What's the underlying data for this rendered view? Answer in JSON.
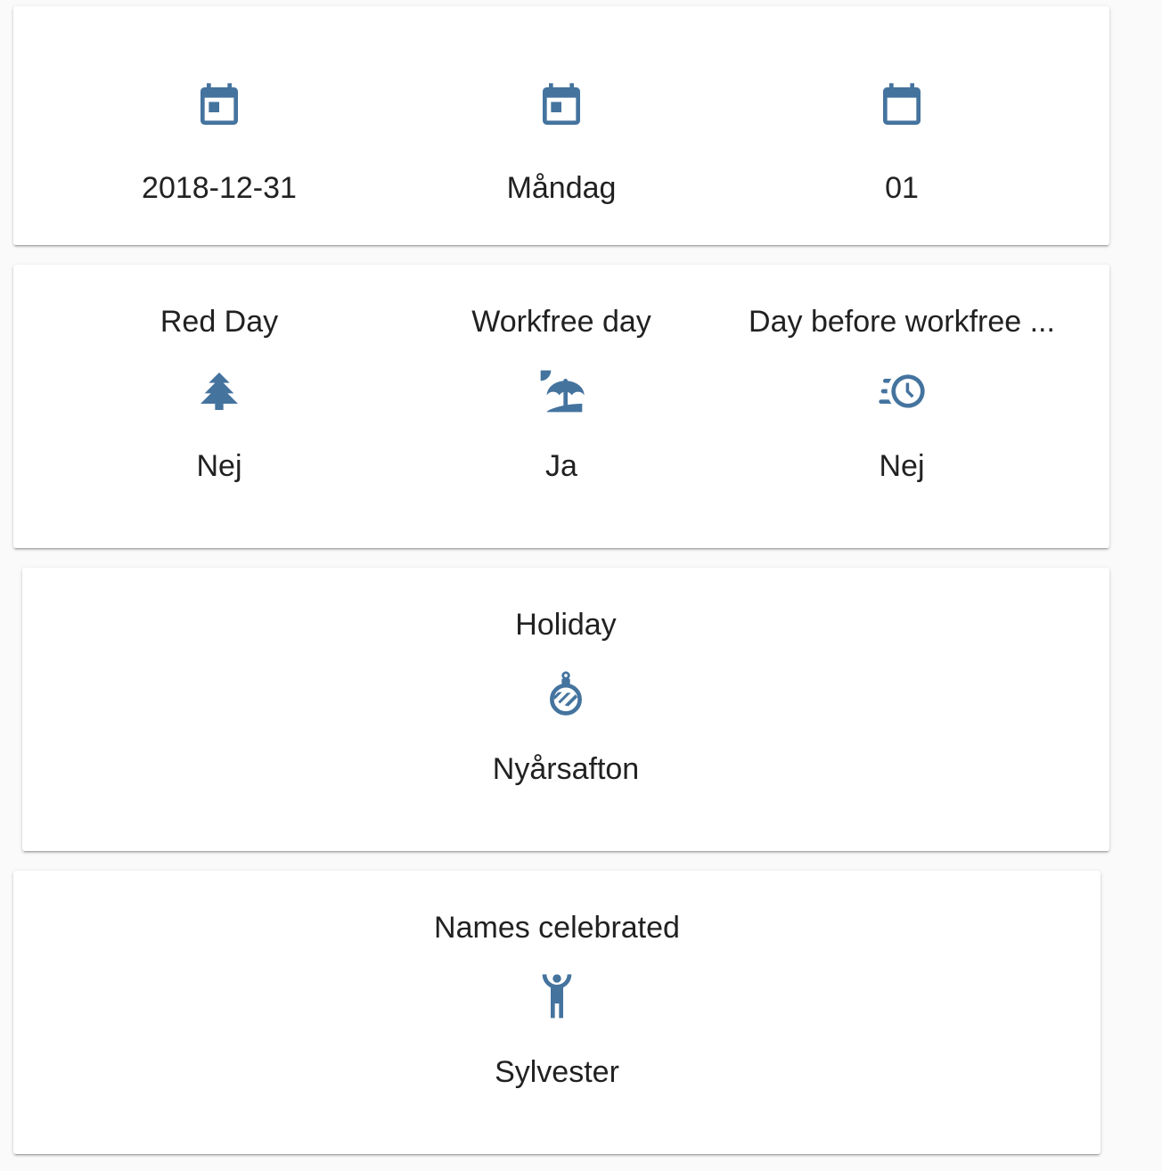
{
  "colors": {
    "icon": "#44739e",
    "text": "#212121",
    "card": "#ffffff",
    "background": "#fafafa"
  },
  "date_card": {
    "items": [
      {
        "icon": "calendar-today-icon",
        "value": "2018-12-31"
      },
      {
        "icon": "calendar-today-icon",
        "value": "Måndag"
      },
      {
        "icon": "calendar-blank-icon",
        "value": "01"
      }
    ]
  },
  "status_card": {
    "items": [
      {
        "label": "Red Day",
        "icon": "pine-tree-icon",
        "value": "Nej"
      },
      {
        "label": "Workfree day",
        "icon": "beach-icon",
        "value": "Ja"
      },
      {
        "label": "Day before workfree ...",
        "icon": "clock-fast-icon",
        "value": "Nej"
      }
    ]
  },
  "holiday_card": {
    "label": "Holiday",
    "icon": "ornament-icon",
    "value": "Nyårsafton"
  },
  "names_card": {
    "label": "Names celebrated",
    "icon": "human-handsup-icon",
    "value": "Sylvester"
  }
}
